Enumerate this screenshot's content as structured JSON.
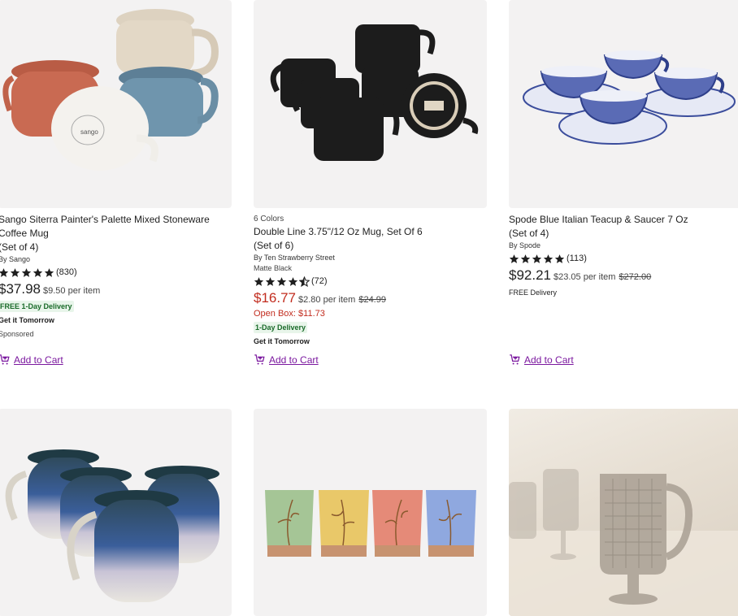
{
  "products": [
    {
      "title": "Sango Siterra Painter's Palette Mixed Stoneware Coffee Mug",
      "set": "(Set of 4)",
      "by": "By Sango",
      "rating": 5,
      "review_count": "(830)",
      "price": "$37.98",
      "per_item": "$9.50 per item",
      "delivery_badge": "FREE 1-Day Delivery",
      "get_it": "Get it Tomorrow",
      "sponsored": "Sponsored",
      "add_to_cart": "Add to Cart"
    },
    {
      "colors": "6 Colors",
      "title": "Double Line 3.75\"/12 Oz Mug, Set Of 6",
      "set": "(Set of 6)",
      "by": "By Ten Strawberry Street",
      "variant": "Matte Black",
      "rating": 4.5,
      "review_count": "(72)",
      "price": "$16.77",
      "per_item": "$2.80 per item",
      "was_price": "$24.99",
      "open_box": "Open Box: $11.73",
      "delivery_badge": "1-Day Delivery",
      "get_it": "Get it Tomorrow",
      "add_to_cart": "Add to Cart"
    },
    {
      "title": "Spode Blue Italian Teacup & Saucer 7 Oz",
      "set": "(Set of 4)",
      "by": "By Spode",
      "rating": 5,
      "review_count": "(113)",
      "price": "$92.21",
      "per_item": "$23.05 per item",
      "was_price": "$272.00",
      "delivery": "FREE Delivery",
      "add_to_cart": "Add to Cart"
    }
  ],
  "images": [
    "mixed-stoneware-mugs-image",
    "matte-black-mugs-image",
    "blue-teacups-saucers-image",
    "reactive-glaze-mugs-image",
    "floral-cups-image",
    "glass-pitcher-goblets-image"
  ],
  "colors": {
    "accent_purple": "#7b189f",
    "sale_red": "#c22d1f",
    "delivery_green_bg": "#e8f5ea",
    "delivery_green_text": "#1a6b2a",
    "image_bg": "#f3f2f2"
  }
}
